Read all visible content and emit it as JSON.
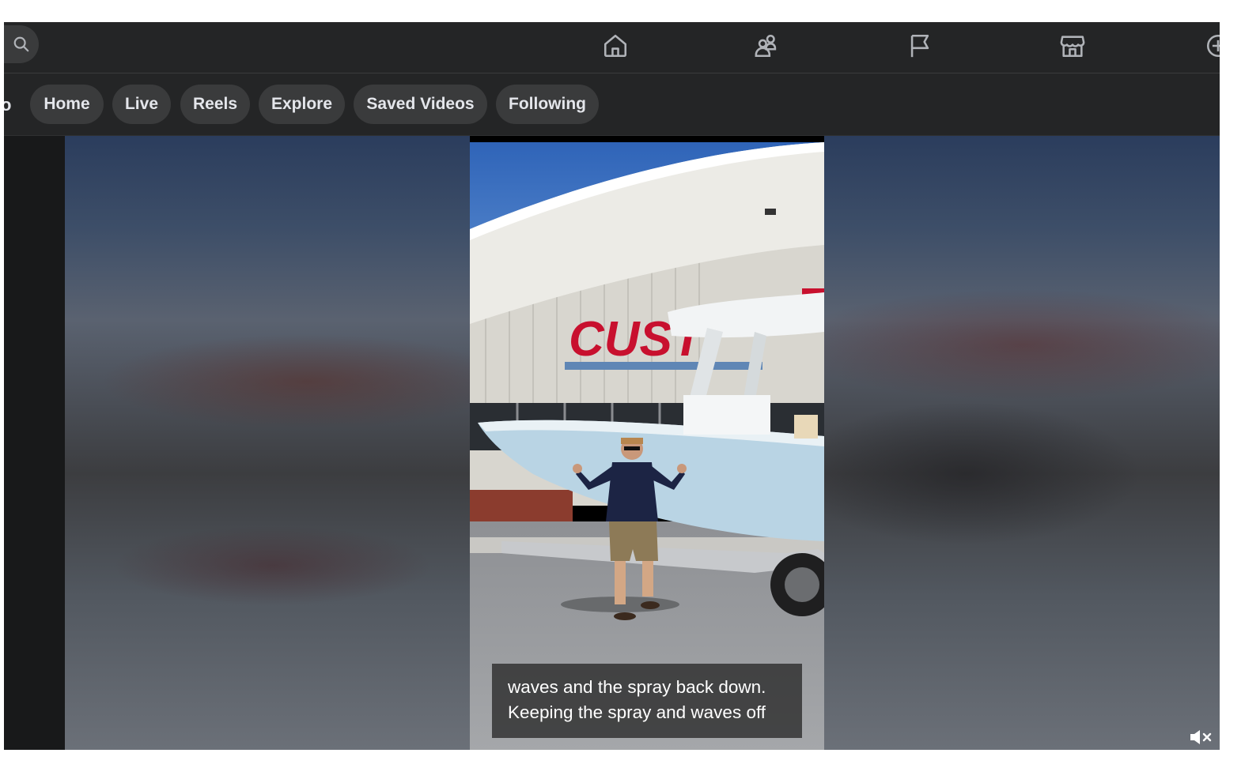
{
  "tabs": [
    {
      "label": "Home"
    },
    {
      "label": "Live"
    },
    {
      "label": "Reels"
    },
    {
      "label": "Explore"
    },
    {
      "label": "Saved Videos"
    },
    {
      "label": "Following"
    }
  ],
  "cut_off_title": "o",
  "nav_icons": [
    "home-icon",
    "friends-icon",
    "pages-flag-icon",
    "marketplace-icon",
    "gaming-icon"
  ],
  "video": {
    "sign_text": "CUST",
    "caption_line1": "waves and the spray back down.",
    "caption_line2": "Keeping the spray and waves off"
  },
  "colors": {
    "bar_bg": "#242526",
    "pill_bg": "#3a3b3c",
    "text": "#e4e6eb",
    "sign_red": "#c8102e"
  }
}
